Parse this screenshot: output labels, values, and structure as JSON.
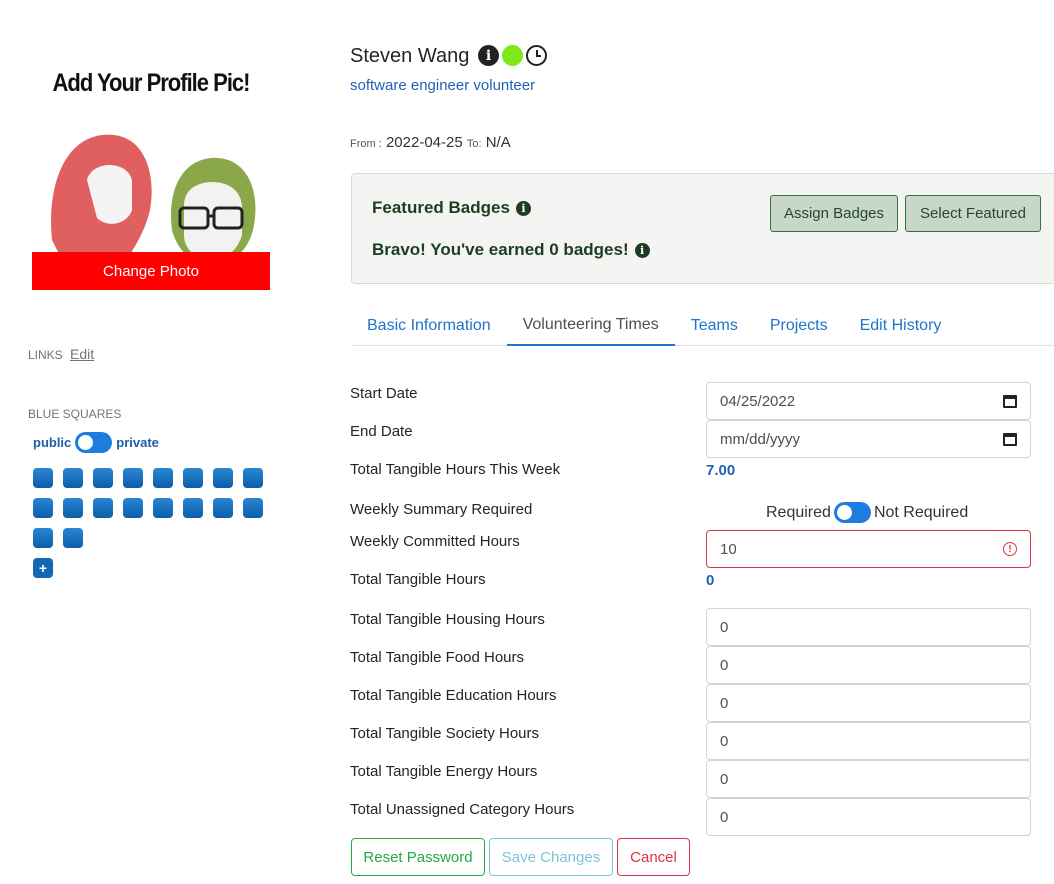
{
  "profile": {
    "pic_heading": "Add Your Profile Pic!",
    "change_photo_label": "Change Photo",
    "name": "Steven Wang",
    "role": "software engineer volunteer",
    "from_label": "From :",
    "from_date": "2022-04-25",
    "to_label": "To:",
    "to_date": "N/A",
    "status_color": "#7fe81a"
  },
  "sidebar": {
    "links_label": "LINKS",
    "links_edit": "Edit",
    "blue_squares_label": "BLUE SQUARES",
    "public_label": "public",
    "private_label": "private",
    "blue_square_count": 18,
    "add_label": "+"
  },
  "badges": {
    "featured_title": "Featured Badges",
    "earned_text": "Bravo! You've earned 0 badges!",
    "assign_label": "Assign Badges",
    "select_label": "Select Featured"
  },
  "tabs": [
    {
      "label": "Basic Information"
    },
    {
      "label": "Volunteering Times",
      "active": true
    },
    {
      "label": "Teams"
    },
    {
      "label": "Projects"
    },
    {
      "label": "Edit History"
    }
  ],
  "form": {
    "start_date_label": "Start Date",
    "start_date_value": "04/25/2022",
    "end_date_label": "End Date",
    "end_date_placeholder": "mm/dd/yyyy",
    "hours_week_label": "Total Tangible Hours This Week",
    "hours_week_value": "7.00",
    "summary_label": "Weekly Summary Required",
    "summary_required": "Required",
    "summary_not_required": "Not Required",
    "committed_label": "Weekly Committed Hours",
    "committed_value": "10",
    "total_hours_label": "Total Tangible Hours",
    "total_hours_value": "0",
    "housing_label": "Total Tangible Housing Hours",
    "housing_value": "0",
    "food_label": "Total Tangible Food Hours",
    "food_value": "0",
    "education_label": "Total Tangible Education Hours",
    "education_value": "0",
    "society_label": "Total Tangible Society Hours",
    "society_value": "0",
    "energy_label": "Total Tangible Energy Hours",
    "energy_value": "0",
    "unassigned_label": "Total Unassigned Category Hours",
    "unassigned_value": "0"
  },
  "actions": {
    "reset_label": "Reset Password",
    "save_label": "Save Changes",
    "cancel_label": "Cancel"
  },
  "icons": {
    "info": "info-icon",
    "status": "status-dot",
    "clock": "clock-icon",
    "calendar": "calendar-icon",
    "error": "error-icon"
  }
}
